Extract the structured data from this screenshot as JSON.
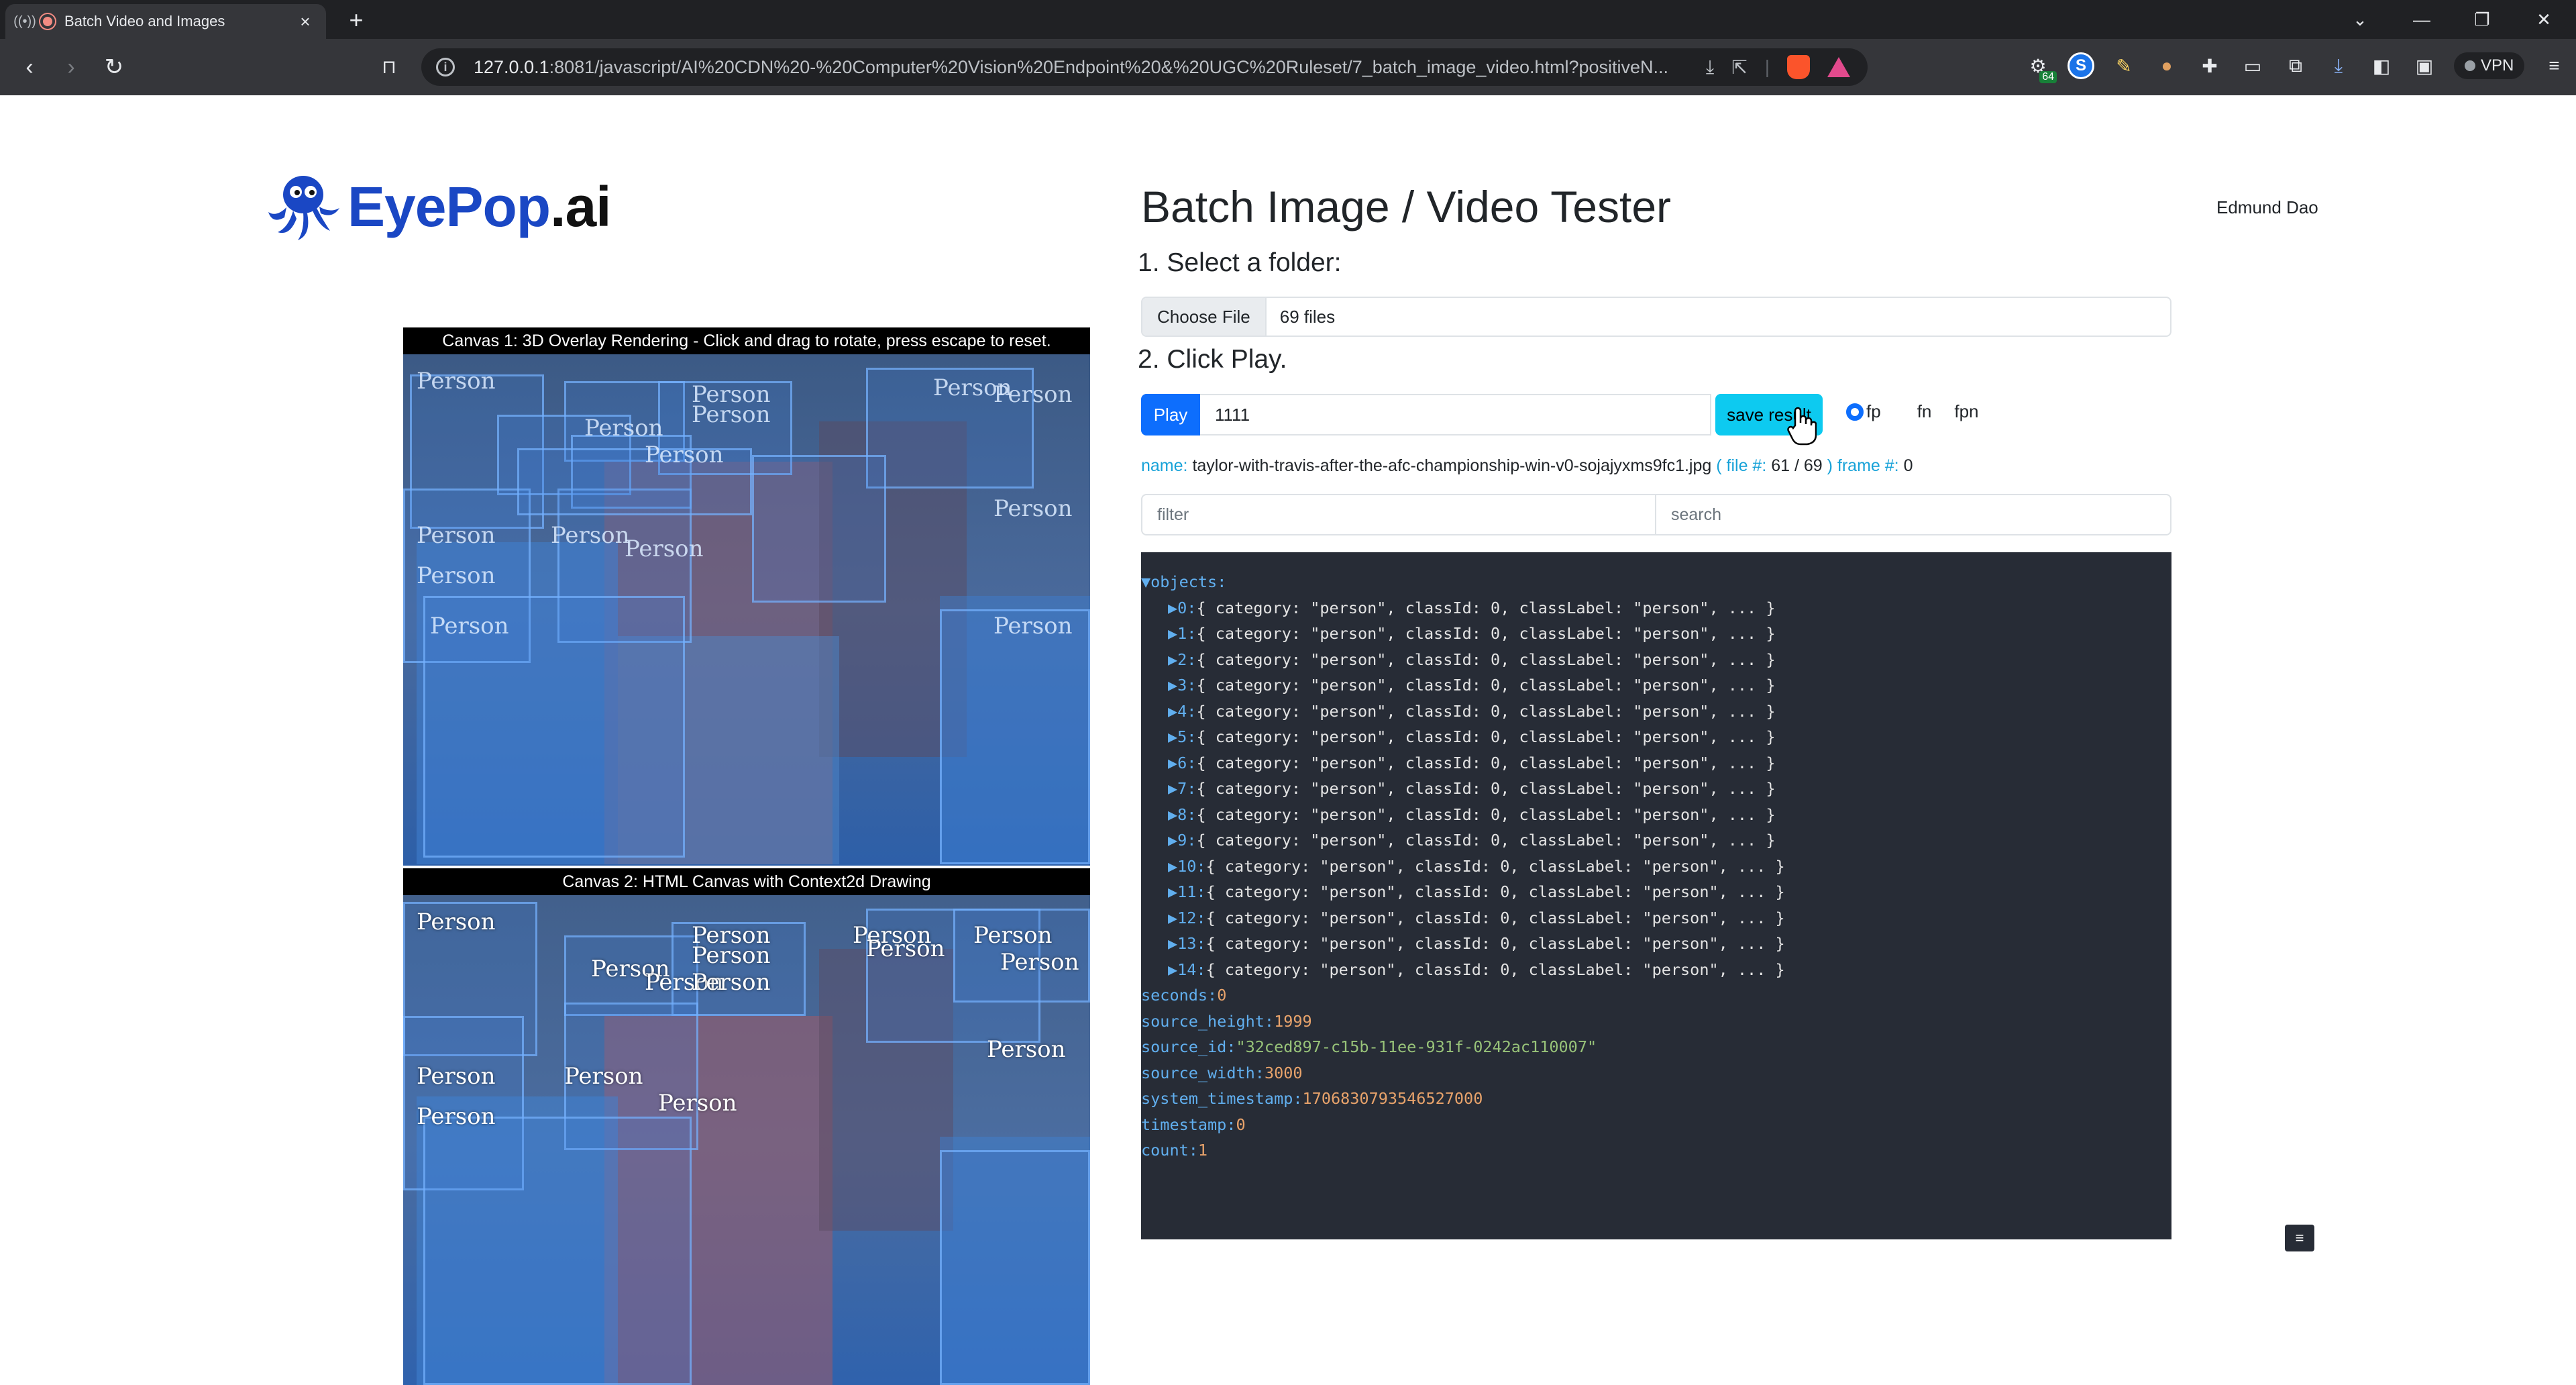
{
  "browser": {
    "tab_title": "Batch Video and Images",
    "url_host": "127.0.0.1",
    "url_rest": ":8081/javascript/AI%20CDN%20-%20Computer%20Vision%20Endpoint%20&%20UGC%20Ruleset/7_batch_image_video.html?positiveN...",
    "vpn_label": "VPN",
    "ext_badge": "64"
  },
  "page": {
    "logo_main": "EyePop",
    "logo_suffix": ".ai",
    "title": "Batch Image / Video Tester",
    "user": "Edmund Dao",
    "step1": "1. Select a folder:",
    "step2": "2. Click Play.",
    "choose_file": "Choose File",
    "file_count": "69 files",
    "play_label": "Play",
    "seed_value": "1111",
    "save_label": "save result",
    "radios": [
      "fp",
      "fn",
      "fpn"
    ],
    "meta": {
      "name_label": "name:",
      "name_value": "taylor-with-travis-after-the-afc-championship-win-v0-sojajyxms9fc1.jpg",
      "file_label": "( file #:",
      "file_value": "61 / 69",
      "frame_label": ") frame #:",
      "frame_value": "0"
    },
    "filter_placeholder": "filter",
    "search_placeholder": "search",
    "mini_btn": "≡"
  },
  "canvas1": {
    "caption": "Canvas 1: 3D Overlay Rendering - Click and drag to rotate, press escape to reset.",
    "labels": [
      "Person",
      "Person",
      "Person",
      "Person",
      "Person",
      "Person",
      "Person",
      "Person",
      "Person",
      "Person",
      "Person",
      "Person",
      "Person",
      "Person"
    ]
  },
  "canvas2": {
    "caption": "Canvas 2: HTML Canvas with Context2d Drawing",
    "labels": [
      "Person",
      "Person",
      "Person",
      "Person",
      "Person",
      "Person",
      "Person",
      "Person",
      "Person",
      "Person",
      "Person",
      "Person",
      "Person",
      "Person",
      "Person"
    ]
  },
  "json": {
    "objects_key": "objects:",
    "items": [
      "0:",
      "1:",
      "2:",
      "3:",
      "4:",
      "5:",
      "6:",
      "7:",
      "8:",
      "9:",
      "10:",
      "11:",
      "12:",
      "13:",
      "14:"
    ],
    "item_body": "{ category: \"person\", classId: 0, classLabel: \"person\", ... }",
    "seconds_key": "seconds:",
    "seconds_val": "0",
    "source_height_key": "source_height:",
    "source_height_val": "1999",
    "source_id_key": "source_id:",
    "source_id_val": "\"32ced897-c15b-11ee-931f-0242ac110007\"",
    "source_width_key": "source_width:",
    "source_width_val": "3000",
    "system_timestamp_key": "system_timestamp:",
    "system_timestamp_val": "1706830793546527000",
    "timestamp_key": "timestamp:",
    "timestamp_val": "0",
    "count_key": "count:",
    "count_val": "1"
  }
}
